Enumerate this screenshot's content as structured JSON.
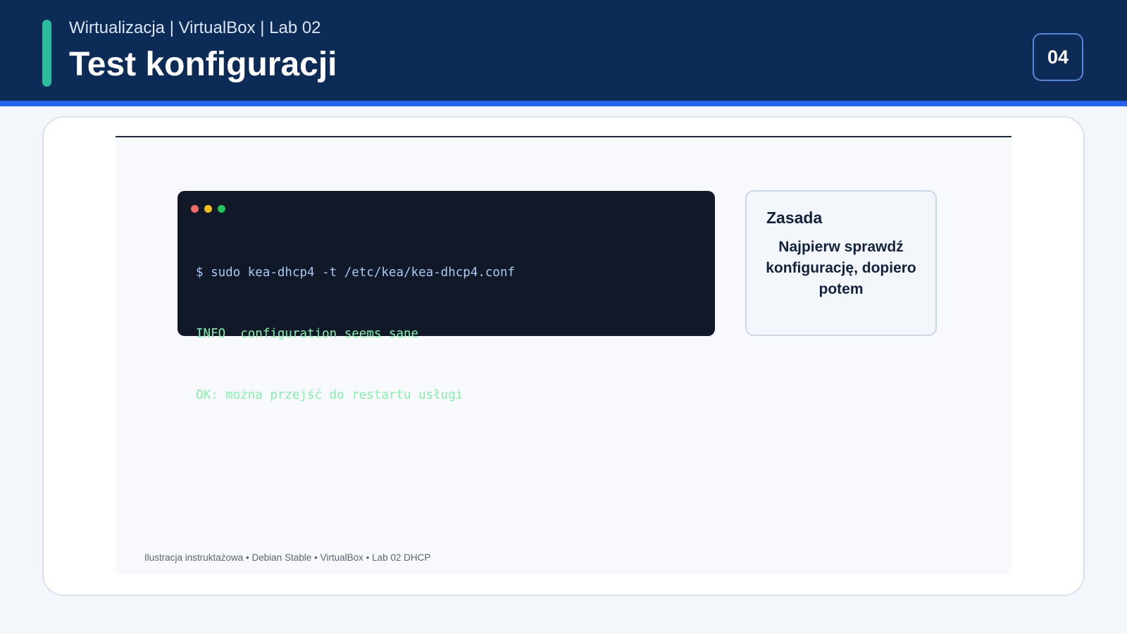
{
  "header": {
    "subtitle": "Wirtualizacja | VirtualBox | Lab 02",
    "title": "Test konfiguracji",
    "slide_number": "04"
  },
  "terminal": {
    "lines": [
      "$ sudo kea-dhcp4 -t /etc/kea/kea-dhcp4.conf",
      "INFO  configuration seems sane",
      "OK: można przejść do restartu usługi"
    ]
  },
  "note": {
    "heading": "Zasada",
    "body": "Najpierw sprawdź konfigurację, dopiero potem"
  },
  "caption": "Ilustracja instruktażowa • Debian Stable • VirtualBox • Lab 02 DHCP",
  "colors": {
    "header_bg": "#0d2b57",
    "accent_stripe": "#2563eb",
    "accent_bar": "#2bbd9c",
    "terminal_bg": "#111827",
    "command_text": "#a9c8f5",
    "output_text": "#86efac"
  }
}
